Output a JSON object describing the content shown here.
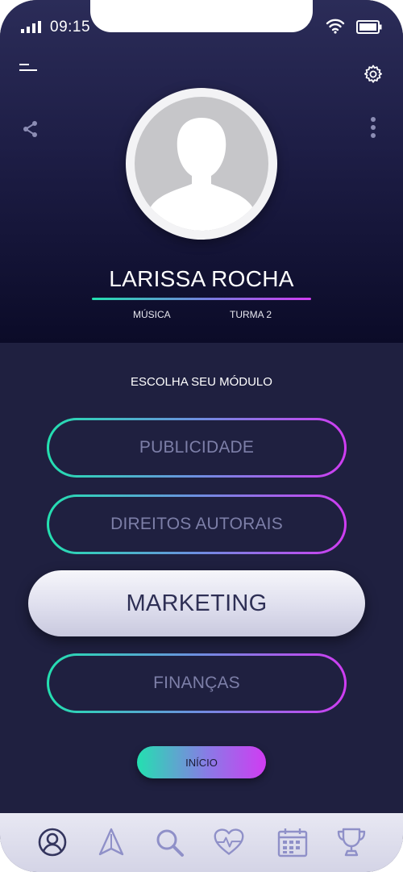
{
  "status_bar": {
    "time": "09:15"
  },
  "header": {
    "icons": {
      "menu": "menu-icon",
      "settings": "gear-icon",
      "share": "share-icon",
      "more": "more-vertical-icon"
    },
    "profile": {
      "name": "LARISSA ROCHA",
      "course": "MÚSICA",
      "class": "TURMA 2"
    }
  },
  "modules": {
    "title": "ESCOLHA SEU MÓDULO",
    "items": [
      {
        "label": "PUBLICIDADE",
        "selected": false
      },
      {
        "label": "DIREITOS AUTORAIS",
        "selected": false
      },
      {
        "label": "MARKETING",
        "selected": true
      },
      {
        "label": "FINANÇAS",
        "selected": false
      }
    ]
  },
  "start_button": {
    "label": "INÍCIO"
  },
  "tabbar": {
    "items": [
      "profile-icon",
      "navigation-icon",
      "search-icon",
      "heart-pulse-icon",
      "calendar-icon",
      "trophy-icon"
    ]
  },
  "colors": {
    "background": "#1f2040",
    "gradient_start": "#23e0b0",
    "gradient_end": "#d03cf2",
    "inactive_text": "#7d7fa8",
    "active_text": "#2e2f55"
  }
}
